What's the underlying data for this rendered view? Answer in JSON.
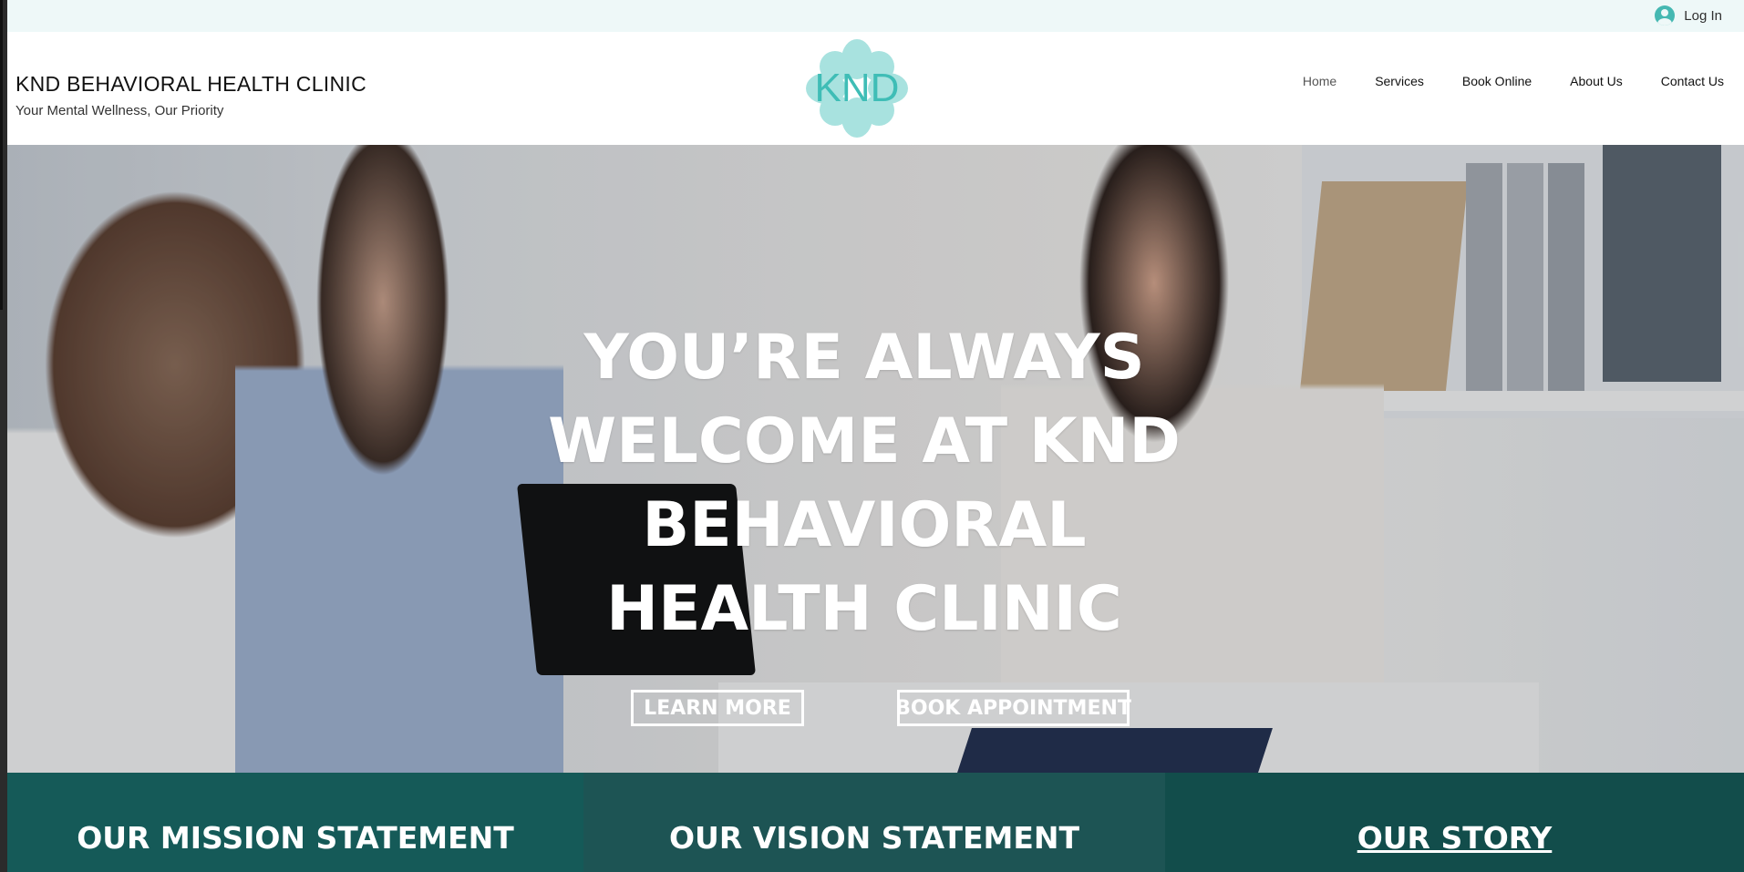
{
  "login": {
    "label": "Log In",
    "icon": "user-avatar-icon"
  },
  "brand": {
    "title": "KND BEHAVIORAL HEALTH CLINIC",
    "subtitle": "Your Mental Wellness, Our Priority",
    "logo_text": "KND",
    "logo_color": "#45c2bc"
  },
  "nav": {
    "items": [
      {
        "label": "Home",
        "active": true
      },
      {
        "label": "Services"
      },
      {
        "label": "Book Online"
      },
      {
        "label": "About Us"
      },
      {
        "label": "Contact Us"
      }
    ]
  },
  "hero": {
    "headline_lines": [
      "YOU’RE ALWAYS",
      "WELCOME AT KND",
      "BEHAVIORAL",
      "HEALTH CLINIC"
    ],
    "buttons": {
      "learn_more": "LEARN MORE",
      "book_appointment": "BOOK APPOINTMENT"
    }
  },
  "band": {
    "mission": "OUR MISSION STATEMENT",
    "vision": "OUR VISION STATEMENT",
    "story": "OUR STORY"
  },
  "colors": {
    "accent": "#45c2bc",
    "band_mission": "#155a58",
    "band_vision": "#1d5454",
    "band_story": "#124d4b"
  }
}
